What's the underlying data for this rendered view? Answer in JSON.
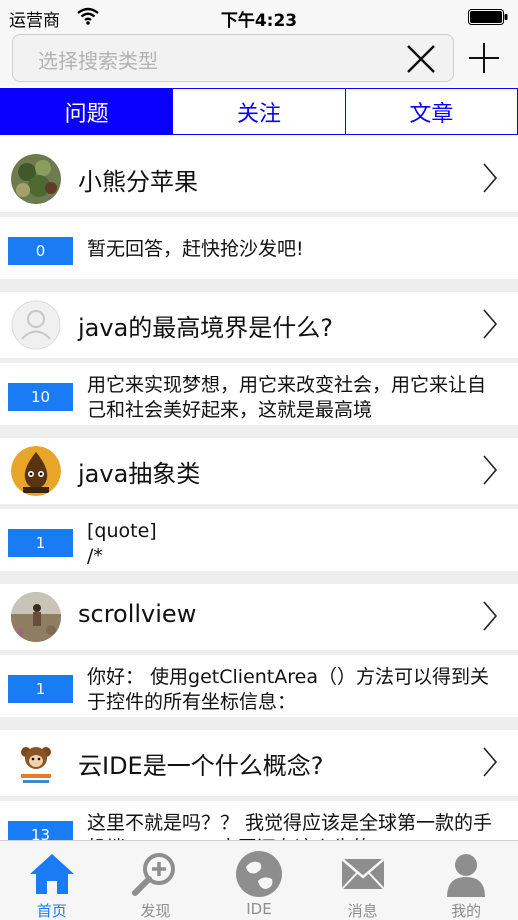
{
  "status_bar": {
    "carrier": "运营商",
    "time": "下午4:23"
  },
  "search": {
    "placeholder": "选择搜索类型"
  },
  "segments": [
    {
      "label": "问题",
      "active": true
    },
    {
      "label": "关注",
      "active": false
    },
    {
      "label": "文章",
      "active": false
    }
  ],
  "questions": [
    {
      "title": "小熊分苹果",
      "answer_count": "0",
      "answer_preview": "暂无回答，赶快抢沙发吧!",
      "avatar": "plant-photo"
    },
    {
      "title": "java的最高境界是什么?",
      "answer_count": "10",
      "answer_preview": "用它来实现梦想，用它来改变社会，用它来让自己和社会美好起来，这就是最高境",
      "avatar": "default-user"
    },
    {
      "title": "java抽象类",
      "answer_count": "1",
      "answer_preview": "[quote]\n/*",
      "avatar": "cocos2d-logo"
    },
    {
      "title": "scrollview",
      "answer_count": "1",
      "answer_preview": "你好： 使用getClientArea（）方法可以得到关于控件的所有坐标信息：",
      "avatar": "field-photo"
    },
    {
      "title": "云IDE是一个什么概念?",
      "answer_count": "13",
      "answer_preview": "这里不就是吗？？ 我觉得应该是全球第一款的手机端java ide，中国还有这么牛的",
      "avatar": "codeant-logo"
    }
  ],
  "tabs": [
    {
      "label": "首页",
      "icon": "home-icon",
      "active": true
    },
    {
      "label": "发现",
      "icon": "discover-icon",
      "active": false
    },
    {
      "label": "IDE",
      "icon": "ide-icon",
      "active": false
    },
    {
      "label": "消息",
      "icon": "message-icon",
      "active": false
    },
    {
      "label": "我的",
      "icon": "profile-icon",
      "active": false
    }
  ],
  "colors": {
    "accent": "#0a00ff",
    "badge": "#1a7cf5",
    "tab_active": "#1a7cf5",
    "tab_inactive": "#8e8e8e"
  }
}
